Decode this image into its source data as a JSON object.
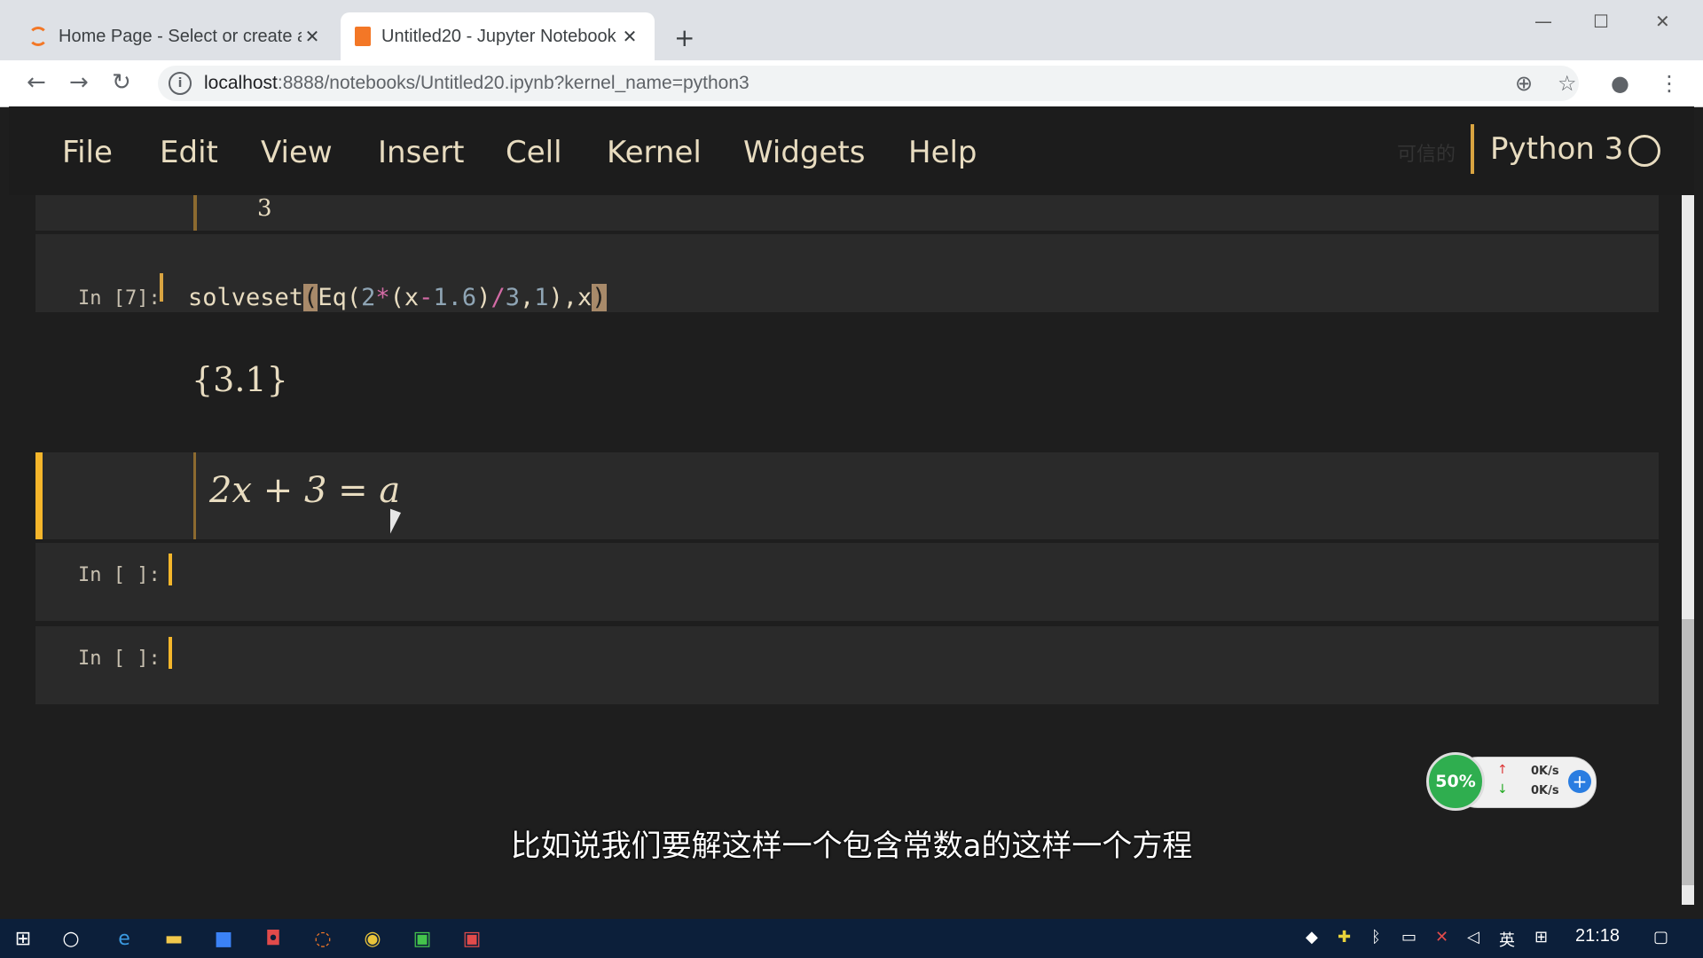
{
  "browser": {
    "tabs": [
      {
        "label": "Home Page - Select or create a",
        "active": false
      },
      {
        "label": "Untitled20 - Jupyter Notebook",
        "active": true
      }
    ],
    "url_host": "localhost",
    "url_rest": ":8888/notebooks/Untitled20.ipynb?kernel_name=python3"
  },
  "jupyter": {
    "menu": [
      "File",
      "Edit",
      "View",
      "Insert",
      "Cell",
      "Kernel",
      "Widgets",
      "Help"
    ],
    "trusted_label": "可信的",
    "kernel_name": "Python 3"
  },
  "cells": {
    "partial_output": "3",
    "cell7": {
      "prompt": "In [7]:",
      "code_prefix": "solveset",
      "code_open": "(",
      "code_eq": "Eq(",
      "code_2": "2",
      "code_star": "*",
      "code_x_open": "(x",
      "code_minus": "-",
      "code_16": "1.6",
      "code_close1": ")",
      "code_slash": "/",
      "code_3": "3",
      "code_comma1": ",",
      "code_1": "1",
      "code_close2": "),x",
      "code_close3": ")",
      "output": "{3.1}"
    },
    "markdown": "2x + 3 = a",
    "empty1_prompt": "In [ ]:",
    "empty2_prompt": "In [ ]:"
  },
  "subtitle": "比如说我们要解这样一个包含常数a的这样一个方程",
  "widget": {
    "percent": "50%",
    "up": "0K/s",
    "down": "0K/s"
  },
  "taskbar": {
    "lang": "英",
    "clock": "21:18"
  }
}
